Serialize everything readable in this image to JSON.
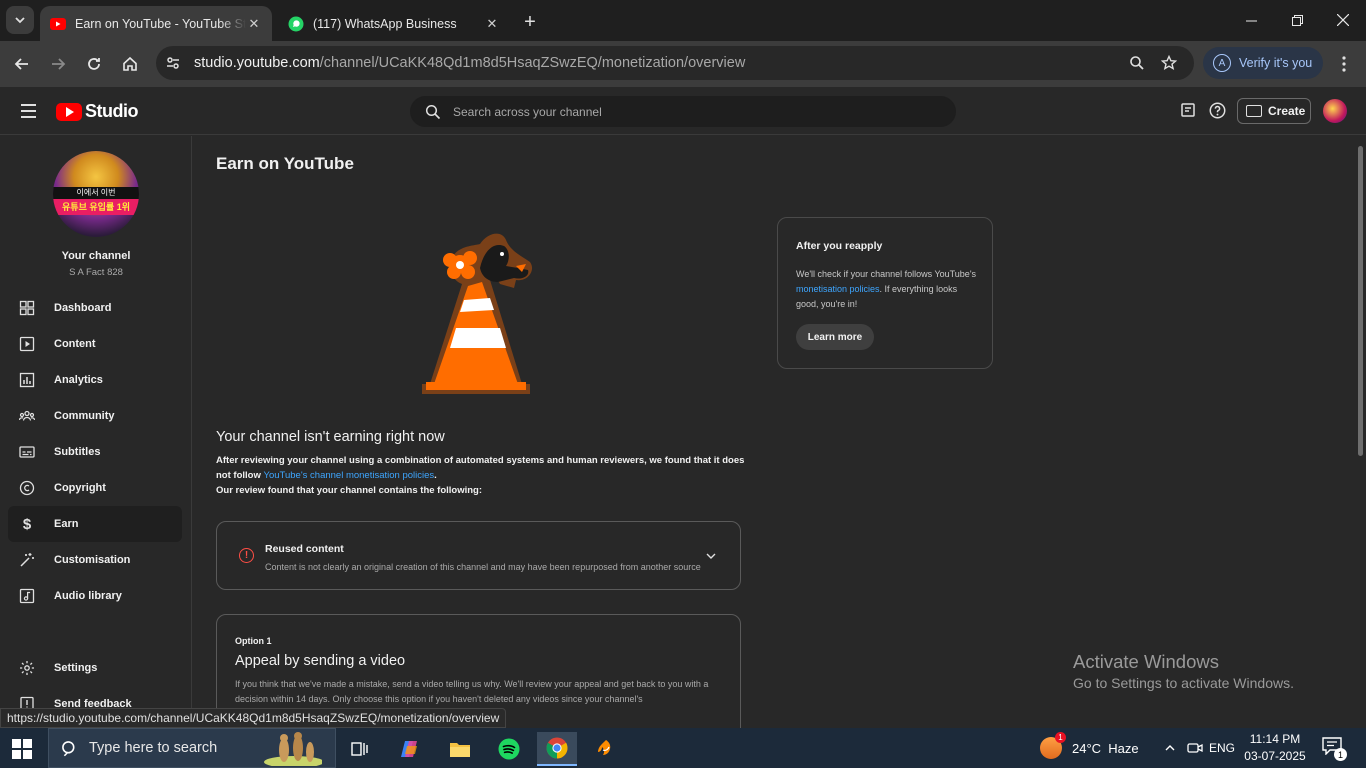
{
  "browser": {
    "tabs": [
      {
        "title": "Earn on YouTube - YouTube Studio",
        "active": true
      },
      {
        "title": "(117) WhatsApp Business",
        "active": false
      }
    ],
    "url_domain": "studio.youtube.com",
    "url_path": "/channel/UCaKK48Qd1m8d5HsaqZSwzEQ/monetization/overview",
    "verify_label": "Verify it's you",
    "verify_avatar": "A",
    "status_url": "https://studio.youtube.com/channel/UCaKK48Qd1m8d5HsaqZSwzEQ/monetization/overview"
  },
  "header": {
    "logo_word": "Studio",
    "search_placeholder": "Search across your channel",
    "create_label": "Create"
  },
  "sidebar": {
    "channel_label": "Your channel",
    "channel_name": "S A Fact 828",
    "avatar_text_top": "이에서 이번",
    "avatar_text_band": "유튜브 유입률 1위",
    "items": [
      {
        "label": "Dashboard",
        "icon": "dashboard-icon"
      },
      {
        "label": "Content",
        "icon": "content-icon"
      },
      {
        "label": "Analytics",
        "icon": "analytics-icon"
      },
      {
        "label": "Community",
        "icon": "community-icon"
      },
      {
        "label": "Subtitles",
        "icon": "subtitles-icon"
      },
      {
        "label": "Copyright",
        "icon": "copyright-icon"
      },
      {
        "label": "Earn",
        "icon": "dollar-icon",
        "active": true
      },
      {
        "label": "Customisation",
        "icon": "magic-wand-icon"
      },
      {
        "label": "Audio library",
        "icon": "audio-library-icon"
      },
      {
        "label": "Settings",
        "icon": "gear-icon"
      },
      {
        "label": "Send feedback",
        "icon": "feedback-icon"
      }
    ]
  },
  "main": {
    "title": "Earn on YouTube",
    "status_heading": "Your channel isn't earning right now",
    "body_1": "After reviewing your channel using a combination of automated systems and human reviewers, we found that it does not follow ",
    "body_link": "YouTube's channel monetisation policies",
    "body_1_end": ".",
    "body_2": "Our review found that your channel contains the following:",
    "issue": {
      "title": "Reused content",
      "description": "Content is not clearly an original creation of this channel and may have been repurposed from another source."
    },
    "option": {
      "label": "Option 1",
      "title": "Appeal by sending a video",
      "description": "If you think that we've made a mistake, send a video telling us why. We'll review your appeal and get back to you with a decision within 14 days. Only choose this option if you haven't deleted any videos since your channel's"
    },
    "info": {
      "title": "After you reapply",
      "body_start": "We'll check if your channel follows YouTube's ",
      "body_link": "monetisation policies",
      "body_end": ". If everything looks good, you're in!",
      "button": "Learn more"
    }
  },
  "watermark": {
    "line1": "Activate Windows",
    "line2": "Go to Settings to activate Windows."
  },
  "taskbar": {
    "search_placeholder": "Type here to search",
    "weather_temp": "24°C",
    "weather_desc": "Haze",
    "weather_badge": "1",
    "language": "ENG",
    "time": "11:14 PM",
    "date": "03-07-2025",
    "notif_count": "1"
  },
  "colors": {
    "accent_link": "#3ea6ff",
    "yt_red": "#ff0000",
    "warning_red": "#ff4e45",
    "cone_orange": "#ff6d00"
  }
}
